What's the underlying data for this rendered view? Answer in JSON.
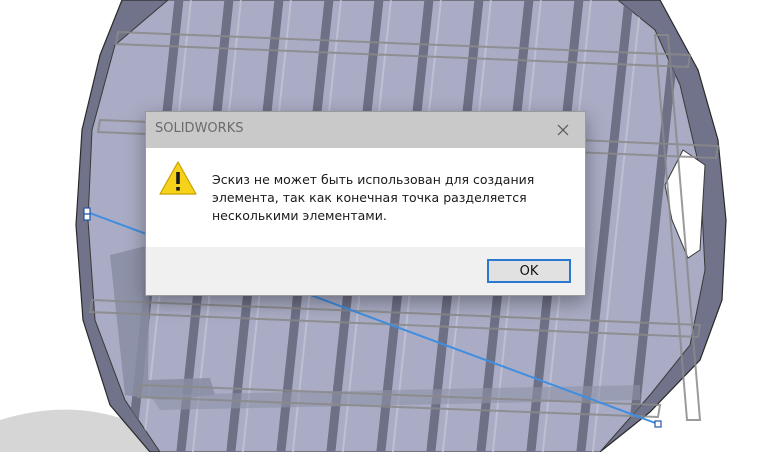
{
  "dialog": {
    "title": "SOLIDWORKS",
    "message_lines": [
      "Эскиз не может быть использован для создания",
      "элемента, так как конечная точка разделяется",
      "несколькими элементами."
    ],
    "ok_label": "OK"
  },
  "colors": {
    "model_face": "#a3a6bf",
    "model_rim": "#70738a",
    "sketch_line": "#3f8ee0",
    "accent_focus": "#2b78d0",
    "warning": "#f7d21a"
  },
  "icons": {
    "dialog_icon": "warning-icon",
    "close": "close-icon"
  }
}
